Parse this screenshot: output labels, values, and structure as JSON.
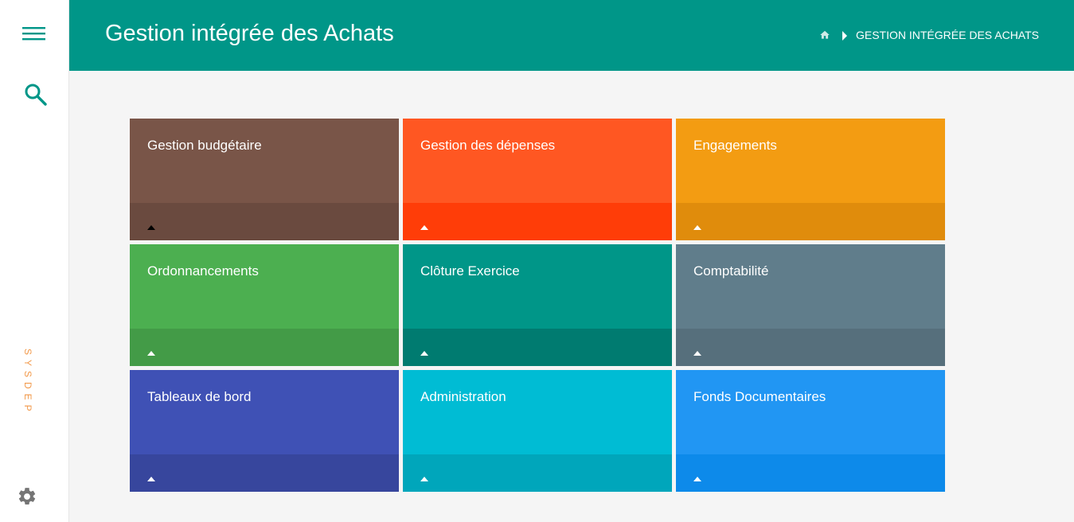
{
  "sidebar": {
    "brand": "SYSDEP",
    "menu_icon": "hamburger-menu-icon",
    "search_icon": "search-icon",
    "settings_icon": "gear-icon"
  },
  "header": {
    "title": "Gestion intégrée des Achats",
    "breadcrumb": {
      "home_icon": "home-icon",
      "separator_icon": "caret-right-icon",
      "current": "GESTION INTÉGRÉE DES ACHATS"
    }
  },
  "colors": {
    "primary": "#009688",
    "sidebar_accent": "#f2994a"
  },
  "tiles": [
    {
      "label": "Gestion budgétaire",
      "color": "#795548",
      "footer_color": "#6a4a3f",
      "caret_color": "#000000"
    },
    {
      "label": "Gestion des dépenses",
      "color": "#ff5722",
      "footer_color": "#ff3d08",
      "caret_color": "#ffffff"
    },
    {
      "label": "Engagements",
      "color": "#f39c12",
      "footer_color": "#e08c0c",
      "caret_color": "#ffffff"
    },
    {
      "label": "Ordonnancements",
      "color": "#4caf50",
      "footer_color": "#439b47",
      "caret_color": "#ffffff"
    },
    {
      "label": "Clôture Exercice",
      "color": "#009688",
      "footer_color": "#007b70",
      "caret_color": "#ffffff"
    },
    {
      "label": "Comptabilité",
      "color": "#607d8b",
      "footer_color": "#566f7c",
      "caret_color": "#ffffff"
    },
    {
      "label": "Tableaux de bord",
      "color": "#3f51b5",
      "footer_color": "#37469d",
      "caret_color": "#ffffff"
    },
    {
      "label": "Administration",
      "color": "#00bcd4",
      "footer_color": "#00a6bb",
      "caret_color": "#ffffff"
    },
    {
      "label": "Fonds Documentaires",
      "color": "#2196f3",
      "footer_color": "#0d8aea",
      "caret_color": "#ffffff"
    }
  ]
}
